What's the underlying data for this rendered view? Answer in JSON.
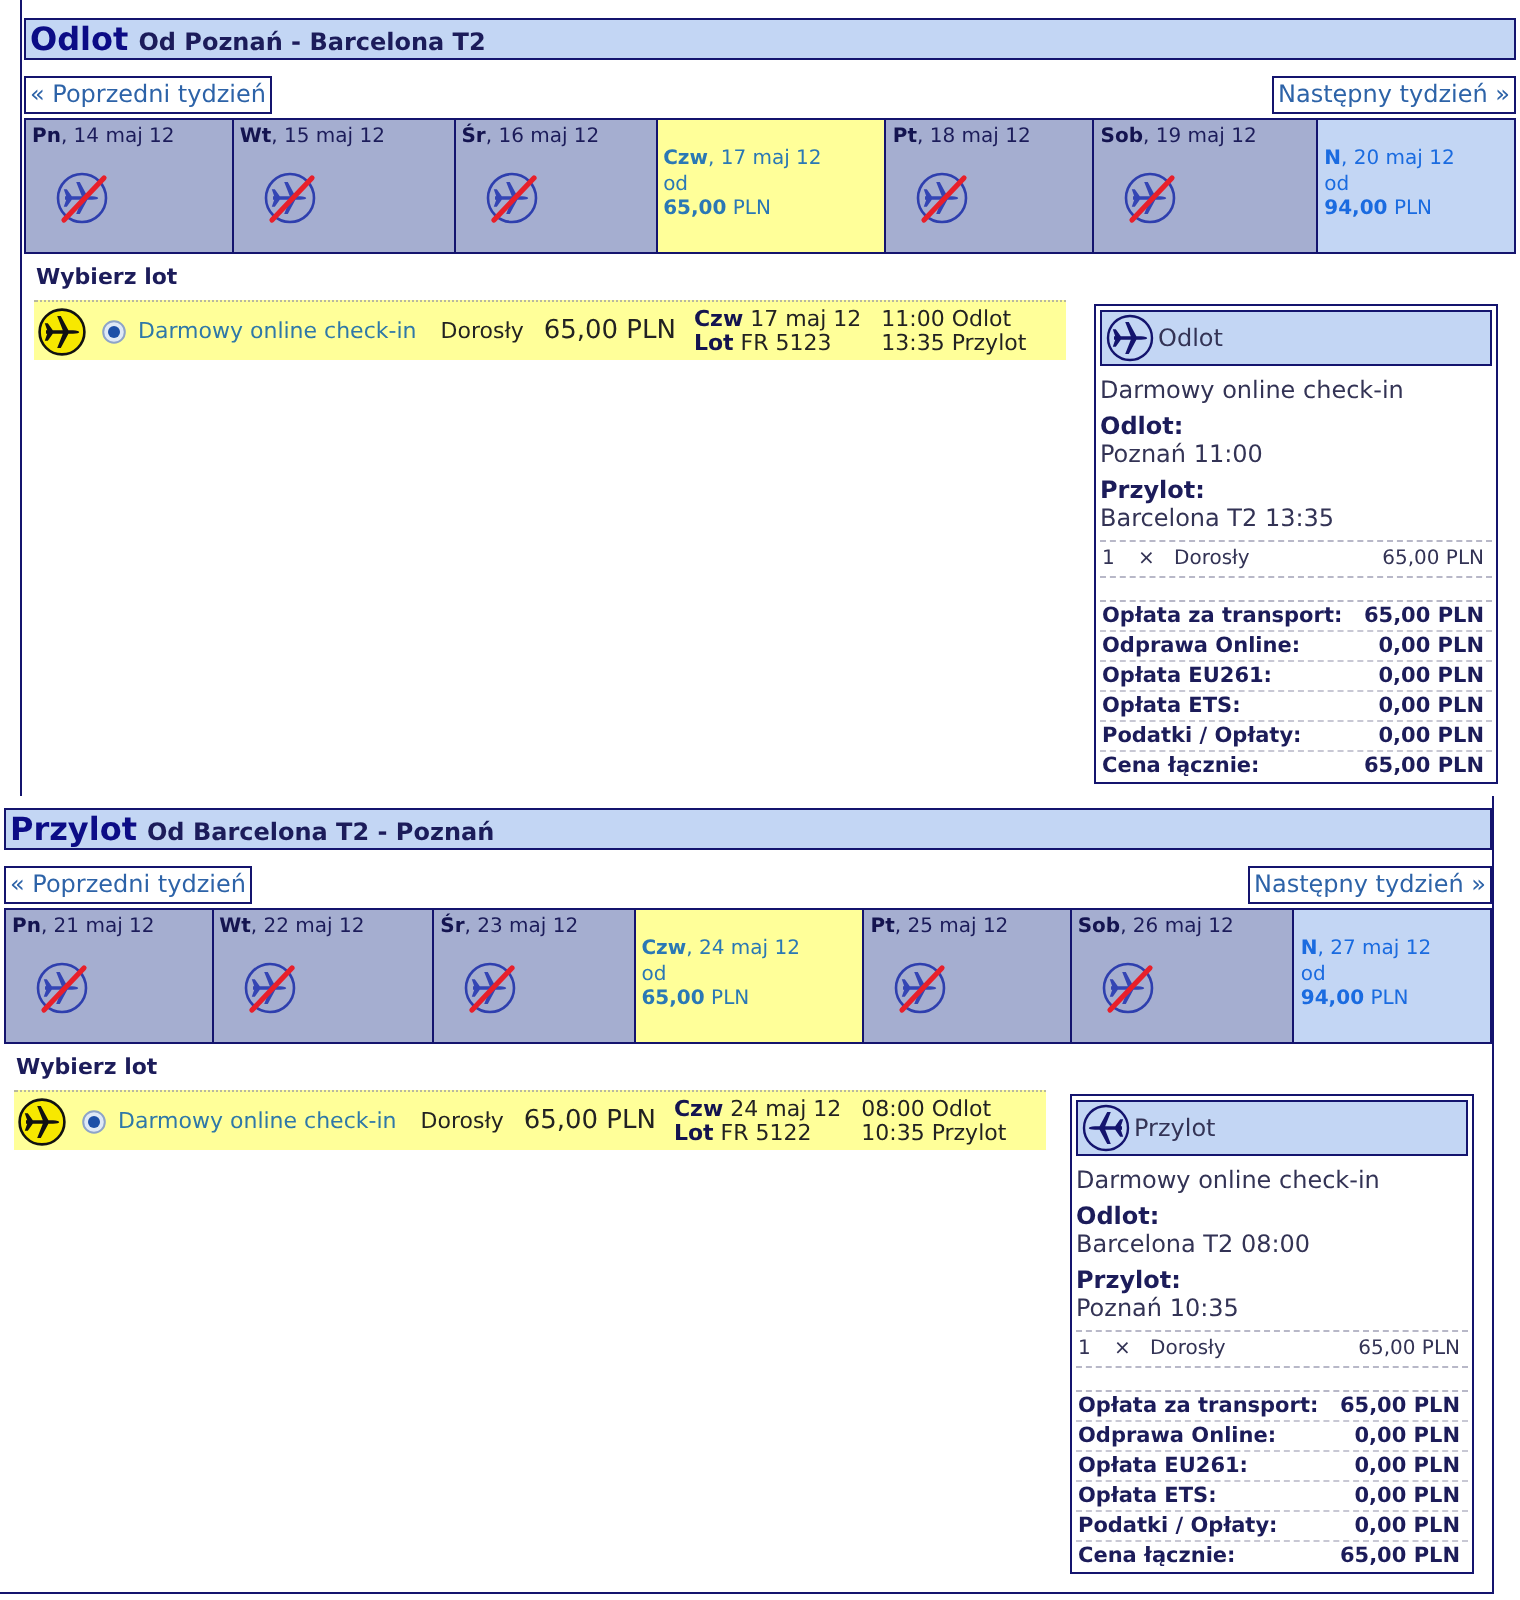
{
  "sections": [
    {
      "title": "Odlot",
      "route": "Od Poznań - Barcelona T2",
      "prev_link": "« Poprzedni tydzień",
      "next_link": "Następny tydzień »",
      "days": [
        {
          "label": "**Pn**, 14 maj 12",
          "available": false,
          "selected": false
        },
        {
          "label": "**Wt**, 15 maj 12",
          "available": false,
          "selected": false
        },
        {
          "label": "**Śr**, 16 maj 12",
          "available": false,
          "selected": false
        },
        {
          "label": "**Czw**, 17 maj 12",
          "available": true,
          "selected": true,
          "from": "od",
          "price": "**65,00** PLN"
        },
        {
          "label": "**Pt**, 18 maj 12",
          "available": false,
          "selected": false
        },
        {
          "label": "**Sob**, 19 maj 12",
          "available": false,
          "selected": false
        },
        {
          "label": "**N**, 20 maj 12",
          "available": true,
          "selected": false,
          "from": "od",
          "price": "**94,00** PLN"
        }
      ],
      "choose_heading": "Wybierz lot",
      "flights": [
        {
          "selected": true,
          "fare": "Darmowy online check-in",
          "passenger": "Dorosły",
          "price": "65,00 PLN",
          "date": "**Czw** 17 maj 12",
          "flight": "**Lot** FR 5123",
          "departure": "11:00 Odlot",
          "arrival": "13:35 Przylot"
        }
      ],
      "summary": {
        "kind": "departure",
        "title": "Odlot",
        "fare": "Darmowy online check-in",
        "departure_label": "Odlot:",
        "departure": "Poznań 11:00",
        "arrival_label": "Przylot:",
        "arrival": "Barcelona T2 13:35",
        "passengers": [
          {
            "count": "1",
            "times": "×",
            "type": "Dorosły",
            "amount": "65,00 PLN"
          }
        ],
        "fees": [
          {
            "label": "Opłata za transport:",
            "amount": "65,00 PLN"
          },
          {
            "label": "Odprawa Online:",
            "amount": "0,00 PLN"
          },
          {
            "label": "Opłata EU261:",
            "amount": "0,00 PLN"
          },
          {
            "label": "Opłata ETS:",
            "amount": "0,00 PLN"
          },
          {
            "label": "Podatki / Opłaty:",
            "amount": "0,00 PLN"
          },
          {
            "label": "Cena łącznie:",
            "amount": "65,00 PLN"
          }
        ]
      }
    },
    {
      "title": "Przylot",
      "route": "Od Barcelona T2 - Poznań",
      "prev_link": "« Poprzedni tydzień",
      "next_link": "Następny tydzień »",
      "days": [
        {
          "label": "**Pn**, 21 maj 12",
          "available": false,
          "selected": false
        },
        {
          "label": "**Wt**, 22 maj 12",
          "available": false,
          "selected": false
        },
        {
          "label": "**Śr**, 23 maj 12",
          "available": false,
          "selected": false
        },
        {
          "label": "**Czw**, 24 maj 12",
          "available": true,
          "selected": true,
          "from": "od",
          "price": "**65,00** PLN"
        },
        {
          "label": "**Pt**, 25 maj 12",
          "available": false,
          "selected": false
        },
        {
          "label": "**Sob**, 26 maj 12",
          "available": false,
          "selected": false
        },
        {
          "label": "**N**, 27 maj 12",
          "available": true,
          "selected": false,
          "from": "od",
          "price": "**94,00** PLN"
        }
      ],
      "choose_heading": "Wybierz lot",
      "flights": [
        {
          "selected": true,
          "fare": "Darmowy online check-in",
          "passenger": "Dorosły",
          "price": "65,00 PLN",
          "date": "**Czw** 24 maj 12",
          "flight": "**Lot** FR 5122",
          "departure": "08:00 Odlot",
          "arrival": "10:35 Przylot"
        }
      ],
      "summary": {
        "kind": "arrival",
        "title": "Przylot",
        "fare": "Darmowy online check-in",
        "departure_label": "Odlot:",
        "departure": "Barcelona T2 08:00",
        "arrival_label": "Przylot:",
        "arrival": "Poznań 10:35",
        "passengers": [
          {
            "count": "1",
            "times": "×",
            "type": "Dorosły",
            "amount": "65,00 PLN"
          }
        ],
        "fees": [
          {
            "label": "Opłata za transport:",
            "amount": "65,00 PLN"
          },
          {
            "label": "Odprawa Online:",
            "amount": "0,00 PLN"
          },
          {
            "label": "Opłata EU261:",
            "amount": "0,00 PLN"
          },
          {
            "label": "Opłata ETS:",
            "amount": "0,00 PLN"
          },
          {
            "label": "Podatki / Opłaty:",
            "amount": "0,00 PLN"
          },
          {
            "label": "Cena łącznie:",
            "amount": "65,00 PLN"
          }
        ]
      }
    }
  ]
}
